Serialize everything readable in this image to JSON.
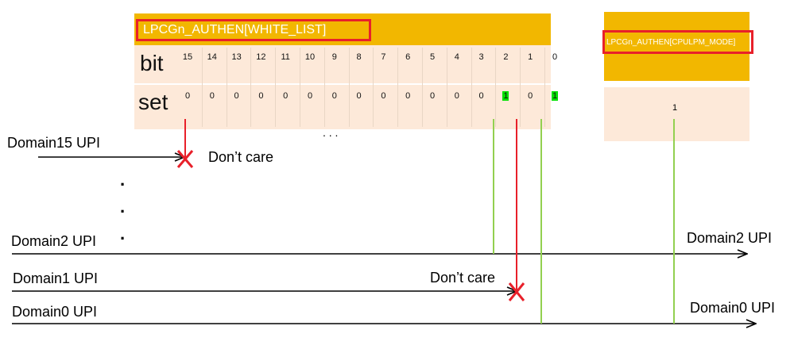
{
  "left_register": {
    "title": "LPCGn_AUTHEN[WHITE_LIST]",
    "bit_row_label": "bit",
    "set_row_label": "set",
    "bits": [
      "15",
      "14",
      "13",
      "12",
      "11",
      "10",
      "9",
      "8",
      "7",
      "6",
      "5",
      "4",
      "3",
      "2",
      "1",
      "0"
    ],
    "values": [
      "0",
      "0",
      "0",
      "0",
      "0",
      "0",
      "0",
      "0",
      "0",
      "0",
      "0",
      "0",
      "0",
      "1",
      "0",
      "1"
    ],
    "ellipsis": ". . ."
  },
  "right_register": {
    "title": "LPCGn_AUTHEN[CPULPM_MODE]",
    "value": "1"
  },
  "domains": {
    "d15": "Domain15 UPI",
    "d2": "Domain2 UPI",
    "d1": "Domain1 UPI",
    "d0": "Domain0 UPI",
    "d2_right": "Domain2 UPI",
    "d0_right": "Domain0 UPI",
    "vertical_dots": [
      "·",
      "·",
      "·"
    ]
  },
  "annotations": {
    "dont_care_1": "Don’t care",
    "dont_care_2": "Don’t care"
  },
  "colors": {
    "header_orange": "#f2b700",
    "peach": "#fde9d9",
    "red": "#e8202a",
    "green": "#92d050",
    "highlight": "#00e000"
  }
}
